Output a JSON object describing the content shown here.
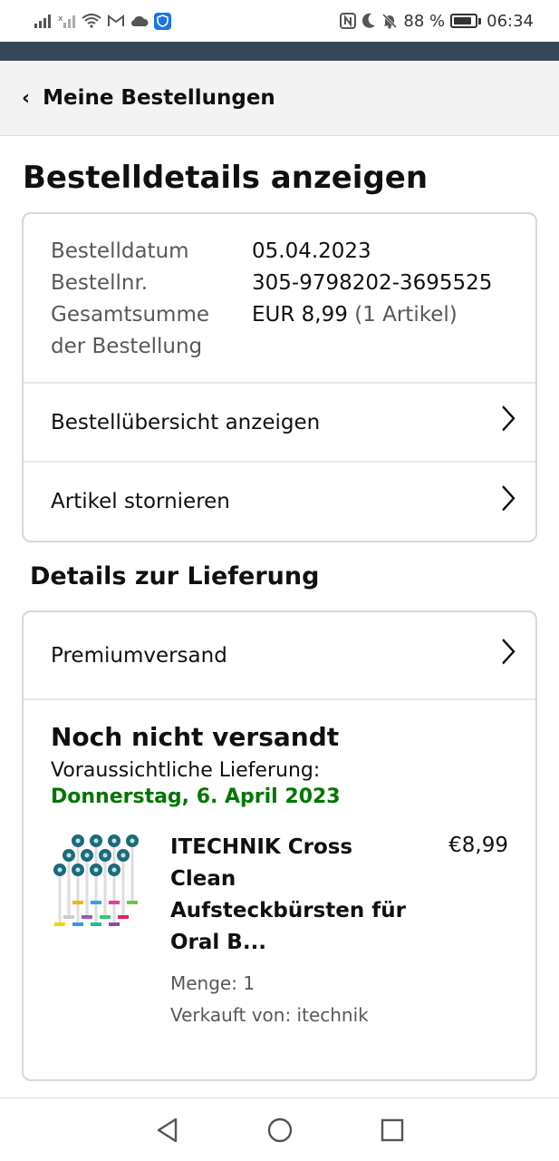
{
  "status_bar": {
    "battery": "88 %",
    "time": "06:34",
    "icons": [
      "signal-icon",
      "signal-no-sim-icon",
      "wifi-icon",
      "gmail-icon",
      "cloud-icon",
      "shield-icon",
      "nfc-icon",
      "moon-icon",
      "bell-off-icon",
      "battery-icon"
    ]
  },
  "header": {
    "back_label": "Meine Bestellungen"
  },
  "page_title": "Bestelldetails anzeigen",
  "order_info": {
    "date_label": "Bestelldatum",
    "date_value": "05.04.2023",
    "number_label": "Bestellnr.",
    "number_value": "305-9798202-3695525",
    "total_label_line1": "Gesamtsumme",
    "total_label_line2": "der Bestellung",
    "total_value": "EUR 8,99",
    "total_items": "(1 Artikel)"
  },
  "links": {
    "overview": "Bestellübersicht anzeigen",
    "cancel": "Artikel stornieren"
  },
  "delivery": {
    "section_title": "Details zur Lieferung",
    "shipping_method": "Premiumversand",
    "status": "Noch nicht versandt",
    "expected_label": "Voraussichtliche Lieferung:",
    "expected_date": "Donnerstag, 6. April 2023"
  },
  "product": {
    "name_line1": "ITECHNIK Cross",
    "name_line2": "Clean",
    "name_line3": "Aufsteckbürsten für",
    "name_line4": "Oral B...",
    "price": "€8,99",
    "quantity": "Menge: 1",
    "seller": "Verkauft von: itechnik"
  },
  "colors": {
    "dark_bar": "#37475a",
    "green": "#007600",
    "muted": "#565959"
  }
}
